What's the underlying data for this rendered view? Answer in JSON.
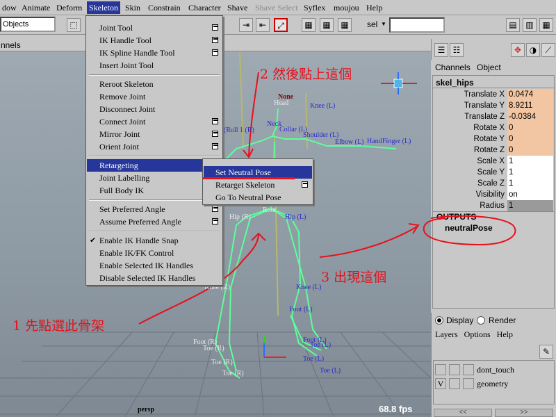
{
  "menubar": {
    "items": [
      "dow",
      "Animate",
      "Deform",
      "Skeleton",
      "Skin",
      "Constrain",
      "Character",
      "Shave",
      "Shave Select",
      "Syflex",
      "moujou",
      "Help"
    ]
  },
  "shelf": {
    "mode": "Objects",
    "sel_label": "sel"
  },
  "viewport": {
    "header": "nnels",
    "camera": "persp",
    "fps": "68.8 fps"
  },
  "skeleton_menu": {
    "items": [
      {
        "label": "Joint Tool"
      },
      {
        "label": "IK Handle Tool"
      },
      {
        "label": "IK Spline Handle Tool"
      },
      {
        "label": "Insert Joint Tool"
      },
      {
        "label": "Reroot Skeleton"
      },
      {
        "label": "Remove Joint"
      },
      {
        "label": "Disconnect Joint"
      },
      {
        "label": "Connect Joint"
      },
      {
        "label": "Mirror Joint"
      },
      {
        "label": "Orient Joint"
      },
      {
        "label": "Retargeting"
      },
      {
        "label": "Joint Labelling"
      },
      {
        "label": "Full Body IK"
      },
      {
        "label": "Set Preferred Angle"
      },
      {
        "label": "Assume Preferred Angle"
      },
      {
        "label": "Enable IK Handle Snap"
      },
      {
        "label": "Enable IK/FK Control"
      },
      {
        "label": "Enable Selected IK Handles"
      },
      {
        "label": "Disable Selected IK Handles"
      }
    ]
  },
  "retarget_submenu": {
    "items": [
      "Set Neutral Pose",
      "Retarget Skeleton",
      "Go To Neutral Pose"
    ]
  },
  "channel_box": {
    "menu": [
      "Channels",
      "Object"
    ],
    "node": "skel_hips",
    "channels": [
      {
        "name": "Translate X",
        "value": "0.0474"
      },
      {
        "name": "Translate Y",
        "value": "8.9211"
      },
      {
        "name": "Translate Z",
        "value": "-0.0384"
      },
      {
        "name": "Rotate X",
        "value": "0"
      },
      {
        "name": "Rotate Y",
        "value": "0"
      },
      {
        "name": "Rotate Z",
        "value": "0"
      },
      {
        "name": "Scale X",
        "value": "1"
      },
      {
        "name": "Scale Y",
        "value": "1"
      },
      {
        "name": "Scale Z",
        "value": "1"
      },
      {
        "name": "Visibility",
        "value": "on"
      },
      {
        "name": "Radius",
        "value": "1"
      }
    ],
    "outputs_title": "OUTPUTS",
    "output_node": "neutralPose"
  },
  "layer_editor": {
    "display_label": "Display",
    "render_label": "Render",
    "menu": [
      "Layers",
      "Options",
      "Help"
    ],
    "layers": [
      {
        "visible": "",
        "name": "dont_touch"
      },
      {
        "visible": "V",
        "name": "geometry"
      }
    ],
    "nav_prev": "<<",
    "nav_next": ">>"
  },
  "joint_labels": {
    "none": "None",
    "head": "Head",
    "neck": "Neck",
    "collar": "Collar (L)",
    "shoulder": "Shoulder (L)",
    "elbow": "Elbow (L)",
    "hand": "Hand",
    "finger": "Finger (L)",
    "knee_top": "Knee (L)",
    "roll": "(Roll 1 (R)",
    "root": "Root",
    "hip_r": "Hip (R)",
    "hip_l": "Hip (L)",
    "knee_r": "Knee (R)",
    "knee_l": "Knee (L)",
    "foot_l": "Foot (L)",
    "foot_r": "Foot (R)",
    "foot_l2": "Foot (L)",
    "toe_r": "Toe (R)",
    "toe_l": "Toe (L)",
    "toe_l2": "Toe (L)",
    "toe_l3": "Toe (L)",
    "toe_r2": "Toe (R)",
    "toe_r3": "Toe (R)"
  },
  "annotations": {
    "step1": "1 先點選此骨架",
    "step2": "2 然後點上這個",
    "step3": "3 出現這個"
  },
  "colors": {
    "menu_highlight": "#26369a",
    "annotation": "#e8101a",
    "joint_green": "#5cff9a",
    "joint_label_blue": "#2a2acc",
    "keyed_channel": "#f2c6a2",
    "selected_channel": "#9a9a9a"
  }
}
